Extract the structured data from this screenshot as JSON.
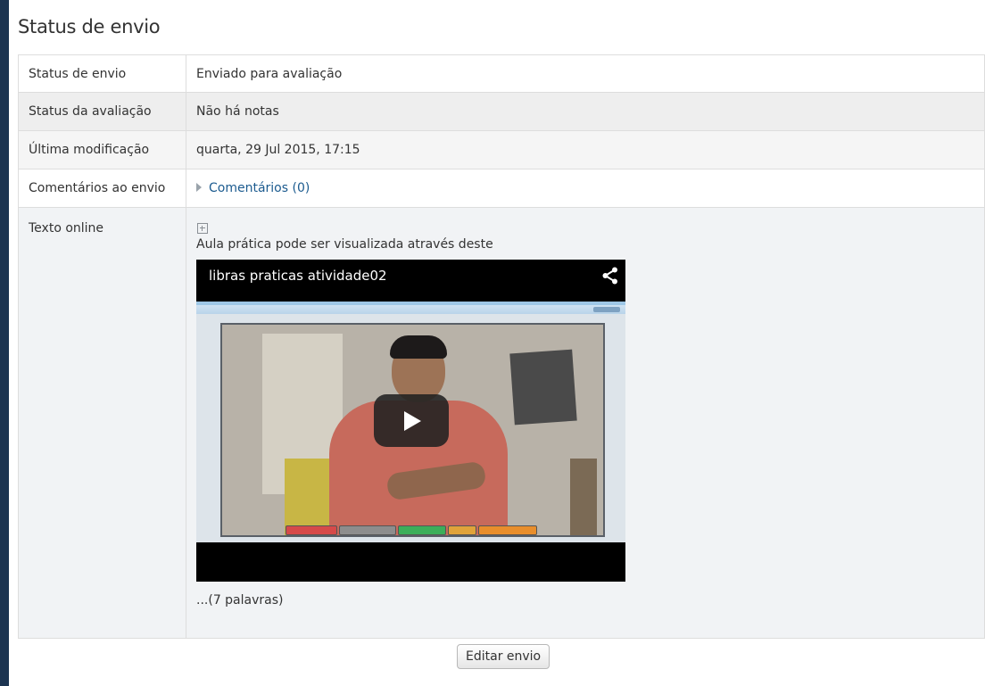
{
  "page_title": "Status de envio",
  "rows": [
    {
      "label": "Status de envio",
      "value": "Enviado para avaliação"
    },
    {
      "label": "Status da avaliação",
      "value": "Não há notas"
    },
    {
      "label": "Última modificação",
      "value": "quarta, 29 Jul 2015, 17:15"
    },
    {
      "label": "Comentários ao envio",
      "value": "Comentários (0)"
    },
    {
      "label": "Texto online",
      "value": "Aula prática pode ser visualizada através deste"
    }
  ],
  "video": {
    "title": "libras praticas atividade02"
  },
  "word_count": "...(7 palavras)",
  "edit_button": "Editar envio",
  "colors": {
    "background": "#1c3451",
    "link": "#1c5b8f",
    "border": "#dddddd"
  },
  "icons": [
    "expand-icon",
    "share-icon",
    "play-icon",
    "collapsed-triangle-icon"
  ]
}
